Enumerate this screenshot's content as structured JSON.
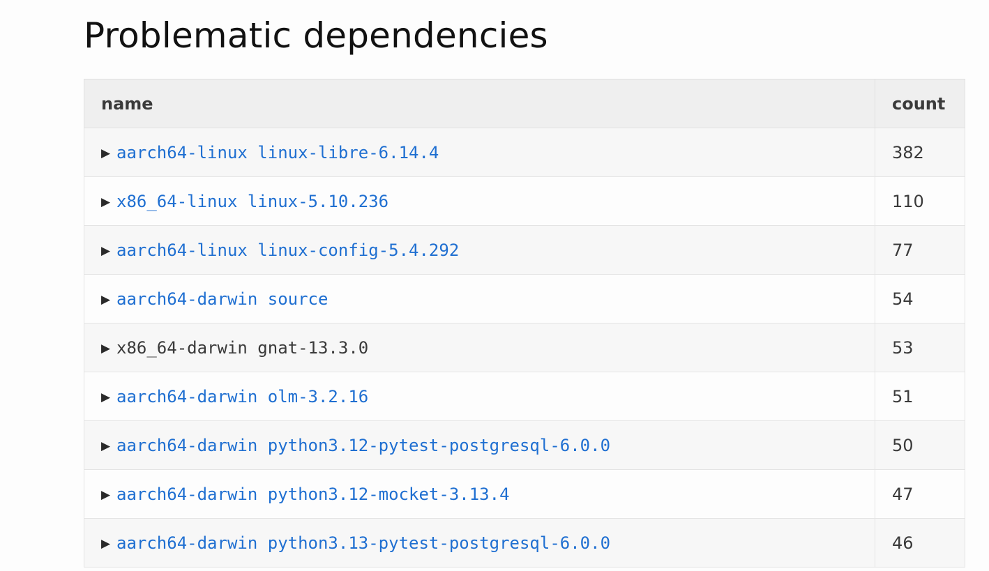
{
  "page": {
    "title": "Problematic dependencies"
  },
  "table": {
    "columns": {
      "name": "name",
      "count": "count"
    },
    "rows": [
      {
        "arrow": "▶",
        "name": "aarch64-linux linux-libre-6.14.4",
        "count": "382",
        "linked": true
      },
      {
        "arrow": "▶",
        "name": "x86_64-linux linux-5.10.236",
        "count": "110",
        "linked": true
      },
      {
        "arrow": "▶",
        "name": "aarch64-linux linux-config-5.4.292",
        "count": "77",
        "linked": true
      },
      {
        "arrow": "▶",
        "name": "aarch64-darwin source",
        "count": "54",
        "linked": true
      },
      {
        "arrow": "▶",
        "name": "x86_64-darwin gnat-13.3.0",
        "count": "53",
        "linked": false
      },
      {
        "arrow": "▶",
        "name": "aarch64-darwin olm-3.2.16",
        "count": "51",
        "linked": true
      },
      {
        "arrow": "▶",
        "name": "aarch64-darwin python3.12-pytest-postgresql-6.0.0",
        "count": "50",
        "linked": true
      },
      {
        "arrow": "▶",
        "name": "aarch64-darwin python3.12-mocket-3.13.4",
        "count": "47",
        "linked": true
      },
      {
        "arrow": "▶",
        "name": "aarch64-darwin python3.13-pytest-postgresql-6.0.0",
        "count": "46",
        "linked": true
      }
    ]
  },
  "colors": {
    "link": "#1f6fd1",
    "text": "#3a3a3a",
    "header_bg": "#efefef",
    "row_alt_bg": "#f7f7f7"
  }
}
